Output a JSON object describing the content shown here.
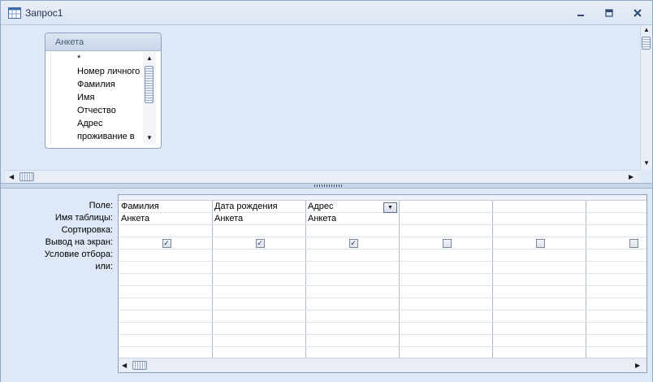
{
  "window": {
    "title": "Запрос1",
    "controls": {
      "minimize": "‗",
      "maximize": "▬",
      "close": "✕"
    }
  },
  "table_box": {
    "name": "Анкета",
    "fields": [
      "*",
      "Номер личного",
      "Фамилия",
      "Имя",
      "Отчество",
      "Адрес",
      "проживание в"
    ]
  },
  "design_grid": {
    "row_labels": [
      "Поле:",
      "Имя таблицы:",
      "Сортировка:",
      "Вывод на экран:",
      "Условие отбора:",
      "или:"
    ],
    "columns": [
      {
        "field": "Фамилия",
        "table": "Анкета",
        "sort": "",
        "show": true,
        "criteria": "",
        "or": ""
      },
      {
        "field": "Дата рождения",
        "table": "Анкета",
        "sort": "",
        "show": true,
        "criteria": "",
        "or": ""
      },
      {
        "field": "Адрес",
        "table": "Анкета",
        "sort": "",
        "show": true,
        "criteria": "",
        "or": ""
      },
      {
        "field": "",
        "table": "",
        "sort": "",
        "show": false,
        "criteria": "",
        "or": ""
      },
      {
        "field": "",
        "table": "",
        "sort": "",
        "show": false,
        "criteria": "",
        "or": ""
      },
      {
        "field": "",
        "table": "",
        "sort": "",
        "show": false,
        "criteria": "",
        "or": ""
      }
    ],
    "active_column_index": 2
  },
  "icons": {
    "window_icon": "query-design-icon",
    "scroll_up": "▲",
    "scroll_down": "▼",
    "scroll_left": "◀",
    "scroll_right": "▶",
    "dropdown": "▼",
    "check": "✓"
  },
  "colors": {
    "background": "#dfe8f6",
    "border": "#8ca1be",
    "title_text": "#1f2f4a"
  }
}
